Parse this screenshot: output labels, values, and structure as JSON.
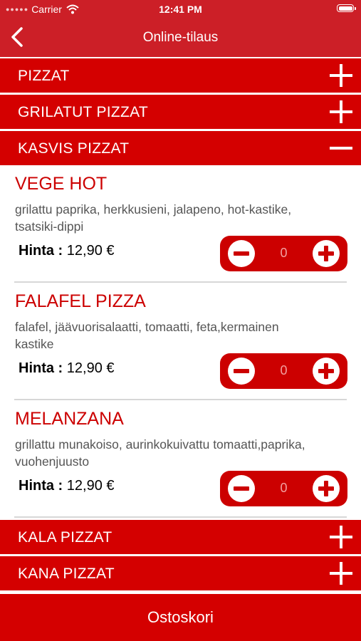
{
  "status_bar": {
    "carrier": "Carrier",
    "time": "12:41 PM",
    "signal_icon": "signal-dots-icon",
    "wifi_icon": "wifi-icon",
    "battery_icon": "battery-icon"
  },
  "nav": {
    "title": "Online-tilaus",
    "back_icon": "chevron-left-icon"
  },
  "categories": [
    {
      "label": "PIZZAT",
      "expanded": false
    },
    {
      "label": "GRILATUT PIZZAT",
      "expanded": false
    },
    {
      "label": "KASVIS PIZZAT",
      "expanded": true
    },
    {
      "label": "KALA PIZZAT",
      "expanded": false
    },
    {
      "label": "KANA PIZZAT",
      "expanded": false
    }
  ],
  "items": [
    {
      "name": "VEGE HOT",
      "description": "grilattu paprika, herkkusieni, jalapeno, hot-kastike, tsatsiki-dippi",
      "price_label": "Hinta :",
      "price": "12,90 €",
      "quantity": "0"
    },
    {
      "name": "FALAFEL PIZZA",
      "description": "falafel, jäävuorisalaatti, tomaatti, feta,kermainen kastike",
      "price_label": "Hinta :",
      "price": "12,90 €",
      "quantity": "0"
    },
    {
      "name": "MELANZANA",
      "description": "grillattu munakoiso, aurinkokuivattu tomaatti,paprika, vuohenjuusto",
      "price_label": "Hinta :",
      "price": "12,90 €",
      "quantity": "0"
    }
  ],
  "cart": {
    "label": "Ostoskori"
  },
  "colors": {
    "header": "#cc1f27",
    "category_bar": "#d40000",
    "item_name": "#cc0000",
    "stepper": "#cc0000"
  }
}
